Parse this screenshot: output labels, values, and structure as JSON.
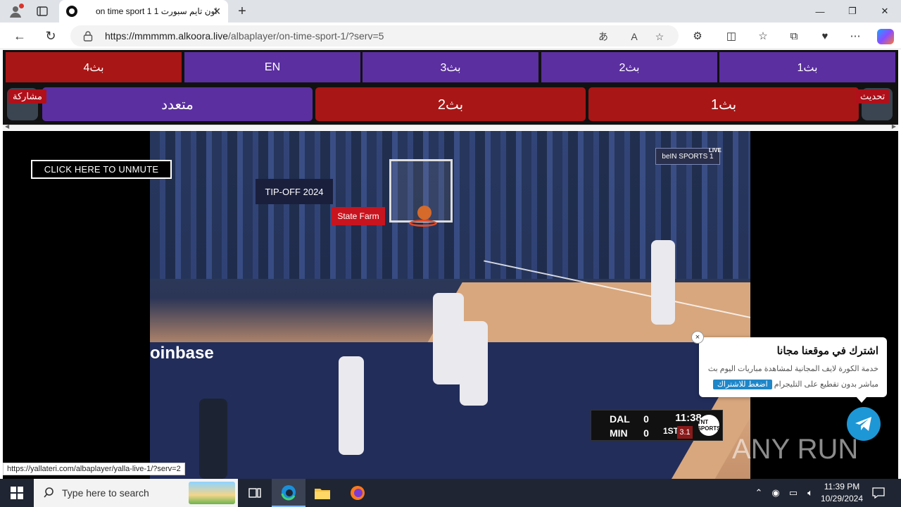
{
  "browser": {
    "tab_title": "on time sport 1 اون تايم سبورت 1",
    "url_host": "https://mmmmm.alkoora.live",
    "url_path": "/albaplayer/on-time-sport-1/?serv=5",
    "status_url": "https://yallateri.com/albaplayer/yalla-live-1/?serv=2"
  },
  "servers_row1": [
    "بث4",
    "EN",
    "بث3",
    "بث2",
    "بث1"
  ],
  "servers_row2": [
    "متعدد",
    "بث2",
    "بث1"
  ],
  "share_label": "مشاركة",
  "refresh_label": "تحديث",
  "player": {
    "unmute_label": "CLICK HERE TO UNMUTE",
    "banner_text": "TIP-OFF 2024",
    "statefarm_text": "State Farm",
    "coinbase_text": "oinbase",
    "channel_logo": "beIN SPORTS 1",
    "channel_live": "LIVE",
    "scoreboard": {
      "team1": "DAL",
      "score1": "0",
      "team2": "MIN",
      "score2": "0",
      "clock": "11:38",
      "quarter": "1ST",
      "shot_clock": "3.1",
      "network": "TNT SPORTS"
    }
  },
  "popup": {
    "title": "اشترك في موقعنا مجانا",
    "description": "خدمة الكورة لايف المجانية لمشاهدة مباريات اليوم بث مباشر بدون تقطيع على التليجرام",
    "button": "اضغط للاشتراك",
    "close": "×"
  },
  "watermark": "ANY RUN",
  "taskbar": {
    "search_placeholder": "Type here to search",
    "time": "11:39 PM",
    "date": "10/29/2024"
  },
  "colors": {
    "red": "#a81616",
    "purple": "#5b2fa0",
    "telegram": "#1d97d6"
  }
}
